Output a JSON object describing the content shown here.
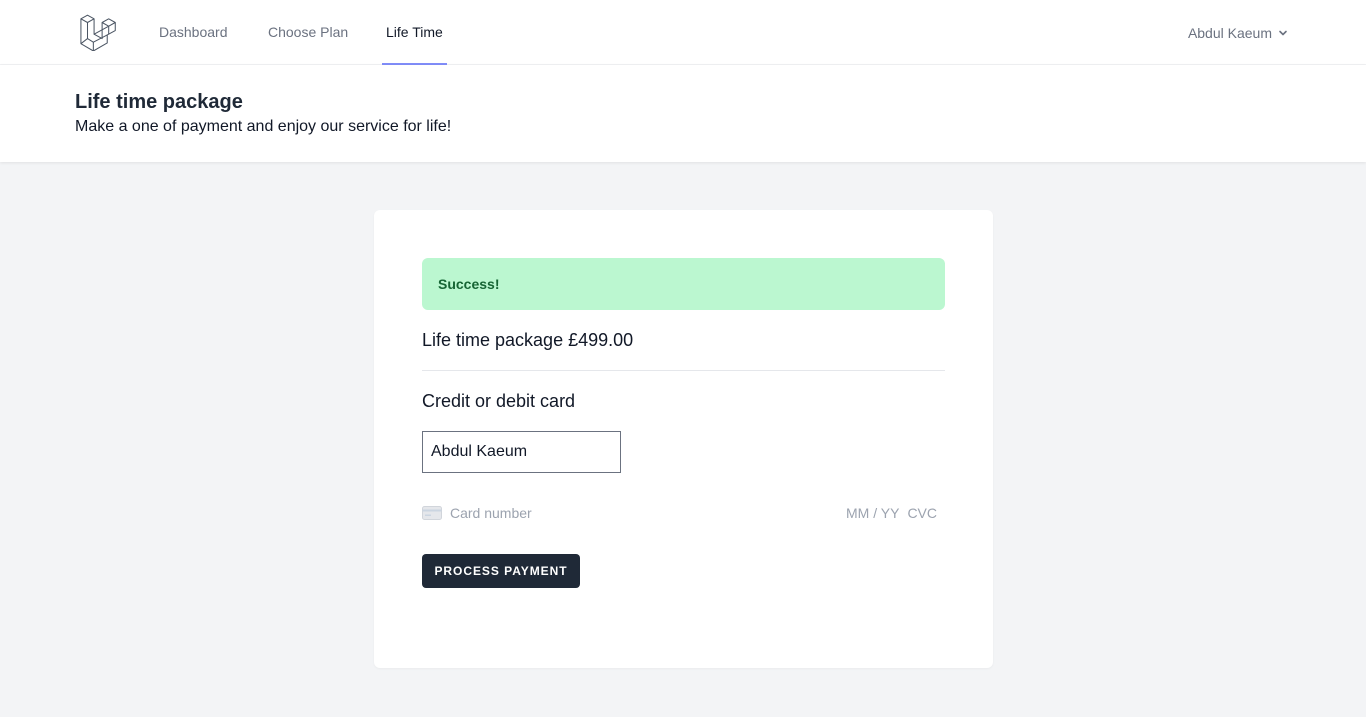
{
  "nav": {
    "links": [
      {
        "label": "Dashboard",
        "active": false
      },
      {
        "label": "Choose Plan",
        "active": false
      },
      {
        "label": "Life Time",
        "active": true
      }
    ],
    "user_name": "Abdul Kaeum",
    "active_indicator_color": "#818cf8"
  },
  "header": {
    "title": "Life time package",
    "subtitle": "Make a one of payment and enjoy our service for life!"
  },
  "payment_card": {
    "alert": {
      "message": "Success!",
      "color": "#bbf7d0"
    },
    "package_line": "Life time package £499.00",
    "card_section_label": "Credit or debit card",
    "cardholder_name_value": "Abdul Kaeum",
    "card_number_placeholder": "Card number",
    "expiry_placeholder": "MM / YY",
    "cvc_placeholder": "CVC",
    "submit_label": "PROCESS PAYMENT",
    "button_color": "#1f2937"
  },
  "icons": {
    "logo": "laravel-logo-icon",
    "user_menu": "chevron-down-icon",
    "card": "credit-card-icon"
  }
}
